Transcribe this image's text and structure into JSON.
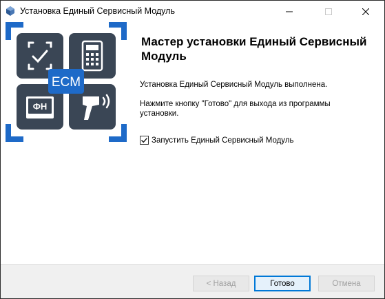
{
  "window": {
    "title": "Установка Единый Сервисный Модуль",
    "icon": "installer-app-icon"
  },
  "titlebar_controls": [
    "minimize-icon",
    "maximize-icon",
    "close-icon"
  ],
  "logo": {
    "badge_text": "ECM",
    "tile_text": "ФН",
    "icons": [
      "face-scan-icon",
      "cash-register-icon",
      "fiscal-drive-icon",
      "barcode-scanner-icon"
    ],
    "accent_color": "#1e6ac8",
    "tile_color": "#3a4655"
  },
  "main": {
    "heading": "Мастер установки Единый Сервисный Модуль",
    "status_text": "Установка Единый Сервисный Модуль выполнена.",
    "instruction_text": "Нажмите кнопку \"Готово\" для выхода из программы установки.",
    "launch_checkbox": {
      "label": "Запустить Единый Сервисный Модуль",
      "checked": true
    }
  },
  "footer": {
    "back_label": "< Назад",
    "finish_label": "Готово",
    "cancel_label": "Отмена"
  }
}
